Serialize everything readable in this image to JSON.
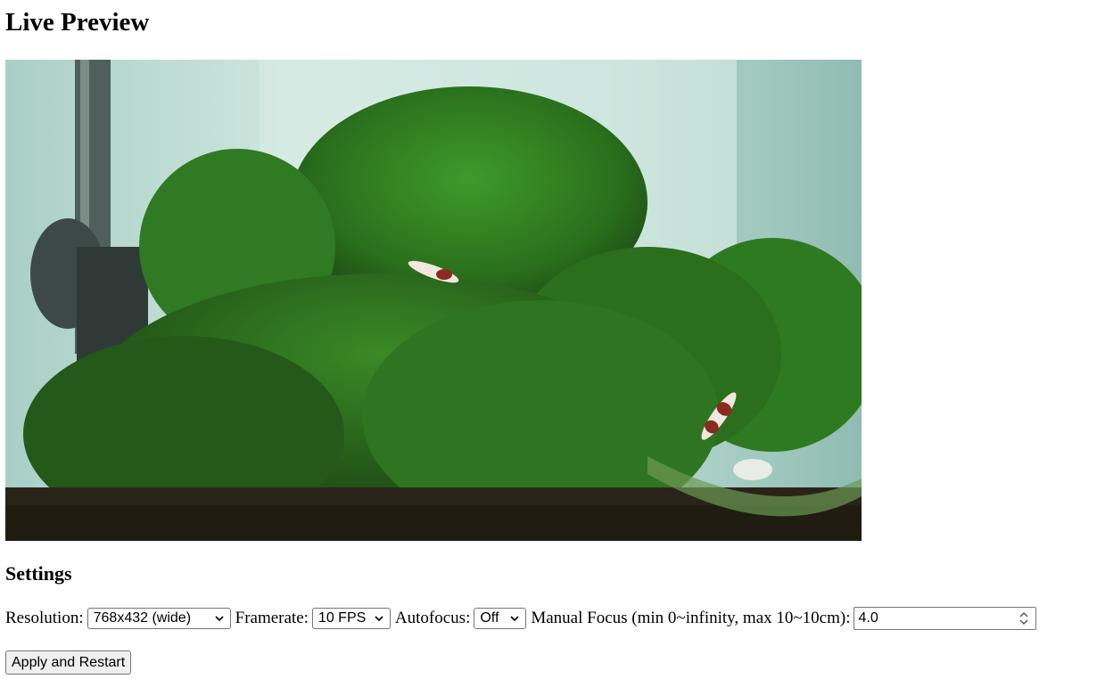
{
  "page": {
    "title": "Live Preview",
    "preview_alt": "Aquarium with green moss, plants and red-and-white shrimp"
  },
  "settings": {
    "heading": "Settings",
    "resolution_label": "Resolution:",
    "resolution_value": "768x432 (wide)",
    "framerate_label": "Framerate:",
    "framerate_value": "10 FPS",
    "autofocus_label": "Autofocus:",
    "autofocus_value": "Off",
    "manual_focus_label": "Manual Focus (min 0~infinity, max 10~10cm):",
    "manual_focus_value": "4.0",
    "apply_label": "Apply and Restart"
  },
  "icons": {
    "dropdown": "chevron-down-icon",
    "spinner": "spinner-arrows-icon"
  }
}
